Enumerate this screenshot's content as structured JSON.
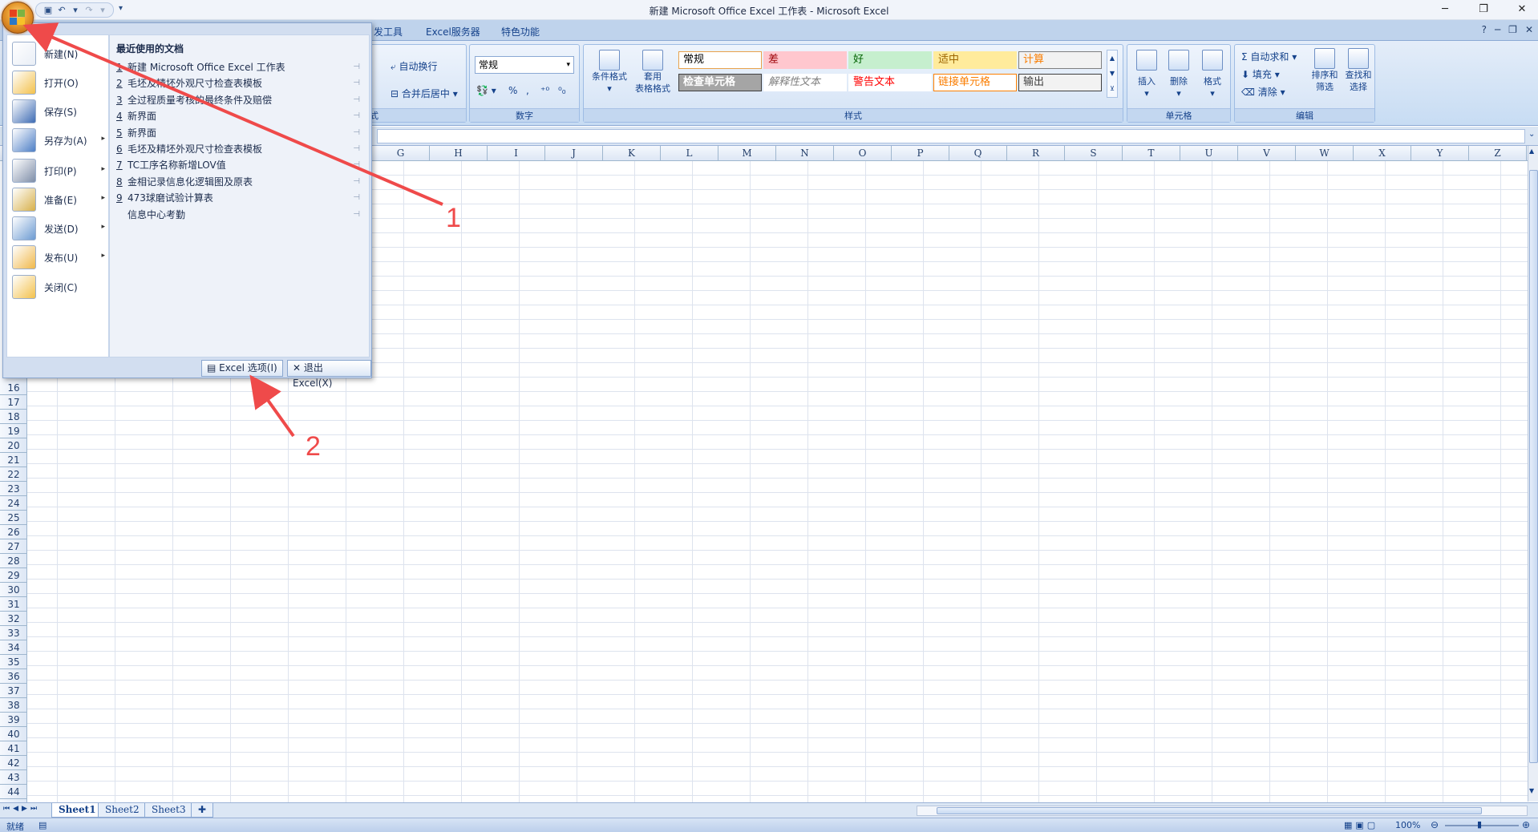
{
  "window": {
    "title": "新建 Microsoft Office Excel 工作表 - Microsoft Excel"
  },
  "ribbon_tabs": [
    "发工具",
    "Excel服务器",
    "特色功能"
  ],
  "ribbon": {
    "alignment": {
      "wrap_text": "自动换行",
      "merge_center": "合并后居中",
      "group_label": "式"
    },
    "number": {
      "format_value": "常规",
      "percent": "%",
      "comma": ",",
      "group_label": "数字"
    },
    "styles": {
      "conditional_format": "条件格式",
      "table_format_1": "套用",
      "table_format_2": "表格格式",
      "group_label": "样式",
      "cells": [
        {
          "label": "常规",
          "bg": "#ffffff",
          "fg": "#000000",
          "border": "#e8a24c"
        },
        {
          "label": "差",
          "bg": "#ffc7ce",
          "fg": "#9c0006",
          "border": "#ffc7ce"
        },
        {
          "label": "好",
          "bg": "#c6efce",
          "fg": "#006100",
          "border": "#c6efce"
        },
        {
          "label": "适中",
          "bg": "#ffeb9c",
          "fg": "#9c6500",
          "border": "#ffeb9c"
        },
        {
          "label": "计算",
          "bg": "#f2f2f2",
          "fg": "#fa7d00",
          "border": "#7f7f7f"
        },
        {
          "label": "检查单元格",
          "bg": "#a5a5a5",
          "fg": "#ffffff",
          "border": "#3f3f3f"
        },
        {
          "label": "解释性文本",
          "bg": "#ffffff",
          "fg": "#7f7f7f",
          "border": "#ffffff"
        },
        {
          "label": "警告文本",
          "bg": "#ffffff",
          "fg": "#ff0000",
          "border": "#ffffff"
        },
        {
          "label": "链接单元格",
          "bg": "#ffffff",
          "fg": "#fa7d00",
          "border": "#ff8001"
        },
        {
          "label": "输出",
          "bg": "#f2f2f2",
          "fg": "#3f3f3f",
          "border": "#3f3f3f"
        }
      ]
    },
    "cells": {
      "insert": "插入",
      "delete": "删除",
      "format": "格式",
      "group_label": "单元格"
    },
    "editing": {
      "autosum": "自动求和",
      "fill": "填充",
      "clear": "清除",
      "sort_1": "排序和",
      "sort_2": "筛选",
      "find_1": "查找和",
      "find_2": "选择",
      "group_label": "编辑"
    }
  },
  "columns": [
    "G",
    "H",
    "I",
    "J",
    "K",
    "L",
    "M",
    "N",
    "O",
    "P",
    "Q",
    "R",
    "S",
    "T",
    "U",
    "V",
    "W",
    "X",
    "Y",
    "Z"
  ],
  "rows": [
    16,
    17,
    18,
    19,
    20,
    21,
    22,
    23,
    24,
    25,
    26,
    27,
    28,
    29,
    30,
    31,
    32,
    33,
    34,
    35,
    36,
    37,
    38,
    39,
    40,
    41,
    42,
    43,
    44
  ],
  "sheets": [
    "Sheet1",
    "Sheet2",
    "Sheet3"
  ],
  "status": {
    "ready": "就绪",
    "zoom": "100%"
  },
  "office_menu": {
    "commands": [
      {
        "label": "新建(N)",
        "icon": "new-document-icon",
        "arrow": false
      },
      {
        "label": "打开(O)",
        "icon": "open-folder-icon",
        "arrow": false
      },
      {
        "label": "保存(S)",
        "icon": "save-disk-icon",
        "arrow": false
      },
      {
        "label": "另存为(A)",
        "icon": "save-as-icon",
        "arrow": true
      },
      {
        "label": "打印(P)",
        "icon": "printer-icon",
        "arrow": true
      },
      {
        "label": "准备(E)",
        "icon": "prepare-icon",
        "arrow": true
      },
      {
        "label": "发送(D)",
        "icon": "send-icon",
        "arrow": true
      },
      {
        "label": "发布(U)",
        "icon": "publish-icon",
        "arrow": true
      },
      {
        "label": "关闭(C)",
        "icon": "close-folder-icon",
        "arrow": false
      }
    ],
    "recent_title": "最近使用的文档",
    "recent_docs": [
      {
        "num": "1",
        "name": "新建 Microsoft Office Excel 工作表"
      },
      {
        "num": "2",
        "name": "毛坯及精坯外观尺寸检查表模板"
      },
      {
        "num": "3",
        "name": "全过程质量考核的最终条件及赔偿"
      },
      {
        "num": "4",
        "name": "新界面"
      },
      {
        "num": "5",
        "name": "新界面"
      },
      {
        "num": "6",
        "name": "毛坯及精坯外观尺寸检查表模板"
      },
      {
        "num": "7",
        "name": "TC工序名称新增LOV值"
      },
      {
        "num": "8",
        "name": "金相记录信息化逻辑图及原表"
      },
      {
        "num": "9",
        "name": "473球磨试验计算表"
      },
      {
        "num": "",
        "name": "信息中心考勤"
      }
    ],
    "excel_options": "Excel 选项(I)",
    "exit_excel": "退出 Excel(X)"
  },
  "annotations": [
    {
      "label": "1",
      "color": "#ef4a4a"
    },
    {
      "label": "2",
      "color": "#ef4a4a"
    }
  ]
}
